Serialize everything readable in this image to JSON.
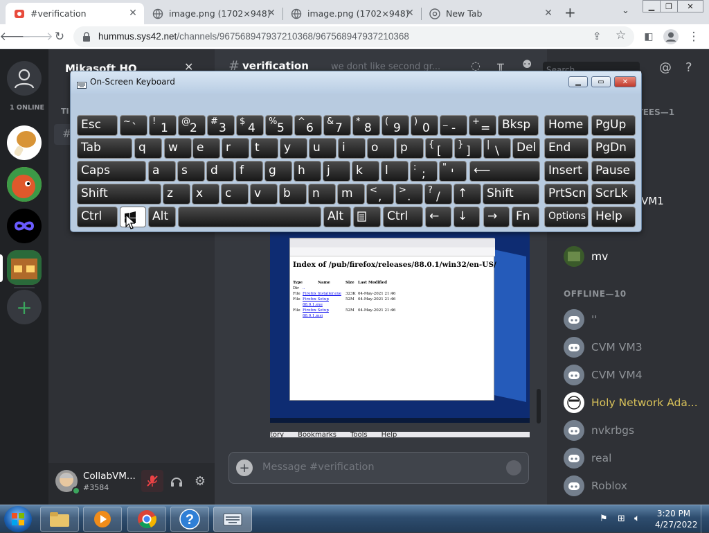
{
  "browser": {
    "tabs": [
      {
        "title": "#verification",
        "active": true
      },
      {
        "title": "image.png (1702×948)",
        "active": false
      },
      {
        "title": "image.png (1702×948)",
        "active": false
      },
      {
        "title": "New Tab",
        "active": false
      }
    ],
    "url_host": "hummus.sys42.net",
    "url_path": "/channels/967568947937210368/967568947937210368"
  },
  "discord": {
    "server_name": "Mikasoft HQ",
    "online_count_label": "1 ONLINE",
    "channel_title": "verification",
    "channel_topic": "we dont like second gr...",
    "search_placeholder": "Search",
    "member_header_partial": "YEES—1",
    "member_partial": "VM1",
    "members_online": [
      {
        "name": "mv"
      }
    ],
    "offline_header": "OFFLINE—10",
    "members_offline": [
      {
        "name": "''"
      },
      {
        "name": "CVM VM3"
      },
      {
        "name": "CVM VM4"
      },
      {
        "name": "Holy Network Ada..."
      },
      {
        "name": "nvkrbgs"
      },
      {
        "name": "real"
      },
      {
        "name": "Roblox"
      }
    ],
    "user": {
      "name": "CollabVM...",
      "tag": "#3584"
    },
    "message_placeholder": "Message #verification",
    "embed": {
      "heading": "Index of /pub/firefox/releases/88.0.1/win32/en-US/",
      "columns": [
        "Type",
        "Name",
        "Size",
        "Last Modified"
      ],
      "rows": [
        [
          "Dir",
          "..",
          "",
          ""
        ],
        [
          "File",
          "Firefox Installer.exe",
          "323K",
          "04-May-2021 21:46"
        ],
        [
          "File",
          "Firefox Setup 88.0.1.exe",
          "52M",
          "04-May-2021 21:46"
        ],
        [
          "File",
          "Firefox Setup 88.0.1.msi",
          "52M",
          "04-May-2021 21:46"
        ]
      ],
      "bottom_menu": [
        "tory",
        "Bookmarks",
        "Tools",
        "Help"
      ]
    }
  },
  "osk": {
    "title": "On-Screen Keyboard",
    "rows": [
      [
        {
          "l": "Esc"
        },
        {
          "s": "~",
          "m": "`"
        },
        {
          "s": "!",
          "m": "1"
        },
        {
          "s": "@",
          "m": "2"
        },
        {
          "s": "#",
          "m": "3"
        },
        {
          "s": "$",
          "m": "4"
        },
        {
          "s": "%",
          "m": "5"
        },
        {
          "s": "^",
          "m": "6"
        },
        {
          "s": "&",
          "m": "7"
        },
        {
          "s": "*",
          "m": "8"
        },
        {
          "s": "(",
          "m": "9"
        },
        {
          "s": ")",
          "m": "0"
        },
        {
          "s": "_",
          "m": "-"
        },
        {
          "s": "+",
          "m": "="
        },
        {
          "l": "Bksp"
        }
      ],
      [
        {
          "l": "Tab"
        },
        {
          "l": "q"
        },
        {
          "l": "w"
        },
        {
          "l": "e"
        },
        {
          "l": "r"
        },
        {
          "l": "t"
        },
        {
          "l": "y"
        },
        {
          "l": "u"
        },
        {
          "l": "i"
        },
        {
          "l": "o"
        },
        {
          "l": "p"
        },
        {
          "s": "{",
          "m": "["
        },
        {
          "s": "}",
          "m": "]"
        },
        {
          "s": "|",
          "m": "\\"
        },
        {
          "l": "Del"
        }
      ],
      [
        {
          "l": "Caps"
        },
        {
          "l": "a"
        },
        {
          "l": "s"
        },
        {
          "l": "d"
        },
        {
          "l": "f"
        },
        {
          "l": "g"
        },
        {
          "l": "h"
        },
        {
          "l": "j"
        },
        {
          "l": "k"
        },
        {
          "l": "l"
        },
        {
          "s": ":",
          "m": ";"
        },
        {
          "s": "\"",
          "m": "'"
        },
        {
          "l": "⟵"
        }
      ],
      [
        {
          "l": "Shift"
        },
        {
          "l": "z"
        },
        {
          "l": "x"
        },
        {
          "l": "c"
        },
        {
          "l": "v"
        },
        {
          "l": "b"
        },
        {
          "l": "n"
        },
        {
          "l": "m"
        },
        {
          "s": "<",
          "m": ","
        },
        {
          "s": ">",
          "m": "."
        },
        {
          "s": "?",
          "m": "/"
        },
        {
          "l": "↑"
        },
        {
          "l": "Shift"
        }
      ],
      [
        {
          "l": "Ctrl"
        },
        {
          "l": "win-logo"
        },
        {
          "l": "Alt"
        },
        {
          "l": ""
        },
        {
          "l": "Alt"
        },
        {
          "l": "menu"
        },
        {
          "l": "Ctrl"
        },
        {
          "l": "←"
        },
        {
          "l": "↓"
        },
        {
          "l": "→"
        },
        {
          "l": "Fn"
        }
      ]
    ],
    "side_rows": [
      [
        "Home",
        "PgUp"
      ],
      [
        "End",
        "PgDn"
      ],
      [
        "Insert",
        "Pause"
      ],
      [
        "PrtScn",
        "ScrLk"
      ],
      [
        "Options",
        "Help"
      ]
    ]
  },
  "taskbar": {
    "time": "3:20 PM",
    "date": "4/27/2022",
    "apps": [
      "start-orb",
      "explorer-icon",
      "media-player-icon",
      "chrome-icon",
      "help-icon",
      "osk-icon"
    ]
  },
  "colors": {
    "discord_bg": "#36393f",
    "accent": "#5865f2",
    "online": "#3ba55d"
  }
}
